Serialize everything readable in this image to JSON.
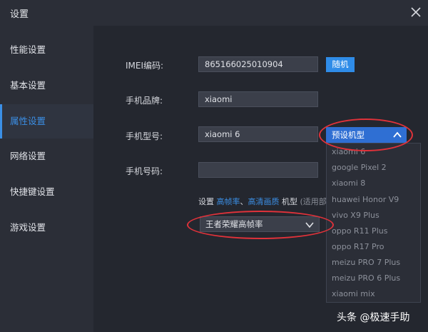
{
  "window": {
    "title": "设置"
  },
  "sidebar": {
    "items": [
      {
        "label": "性能设置"
      },
      {
        "label": "基本设置"
      },
      {
        "label": "属性设置"
      },
      {
        "label": "网络设置"
      },
      {
        "label": "快捷键设置"
      },
      {
        "label": "游戏设置"
      }
    ],
    "active_index": 2
  },
  "form": {
    "imei_label": "IMEI编码:",
    "imei_value": "865166025010904",
    "random_button": "随机",
    "brand_label": "手机品牌:",
    "brand_value": "xiaomi",
    "model_label": "手机型号:",
    "model_value": "xiaomi 6",
    "phone_label": "手机号码:",
    "phone_value": ""
  },
  "preset": {
    "label": "预设机型",
    "options": [
      "xiaomi 6",
      "google Pixel 2",
      "xiaomi 8",
      "huawei Honor V9",
      "vivo X9 Plus",
      "oppo R11 Plus",
      "oppo R17 Pro",
      "meizu PRO 7 Plus",
      "meizu PRO 6 Plus",
      "xiaomi mix"
    ]
  },
  "hint": {
    "prefix": "设置",
    "link1": "高帧率",
    "sep": "、",
    "link2": "高清画质",
    "middle": "机型",
    "suffix": "(适用部"
  },
  "game_select": {
    "value": "王者荣耀高帧率"
  },
  "colors": {
    "accent": "#3b8fe6",
    "button": "#2f8ce8",
    "annotation": "#e0323a",
    "background": "#24272f"
  },
  "watermark": {
    "text": "头条 @极速手助"
  }
}
